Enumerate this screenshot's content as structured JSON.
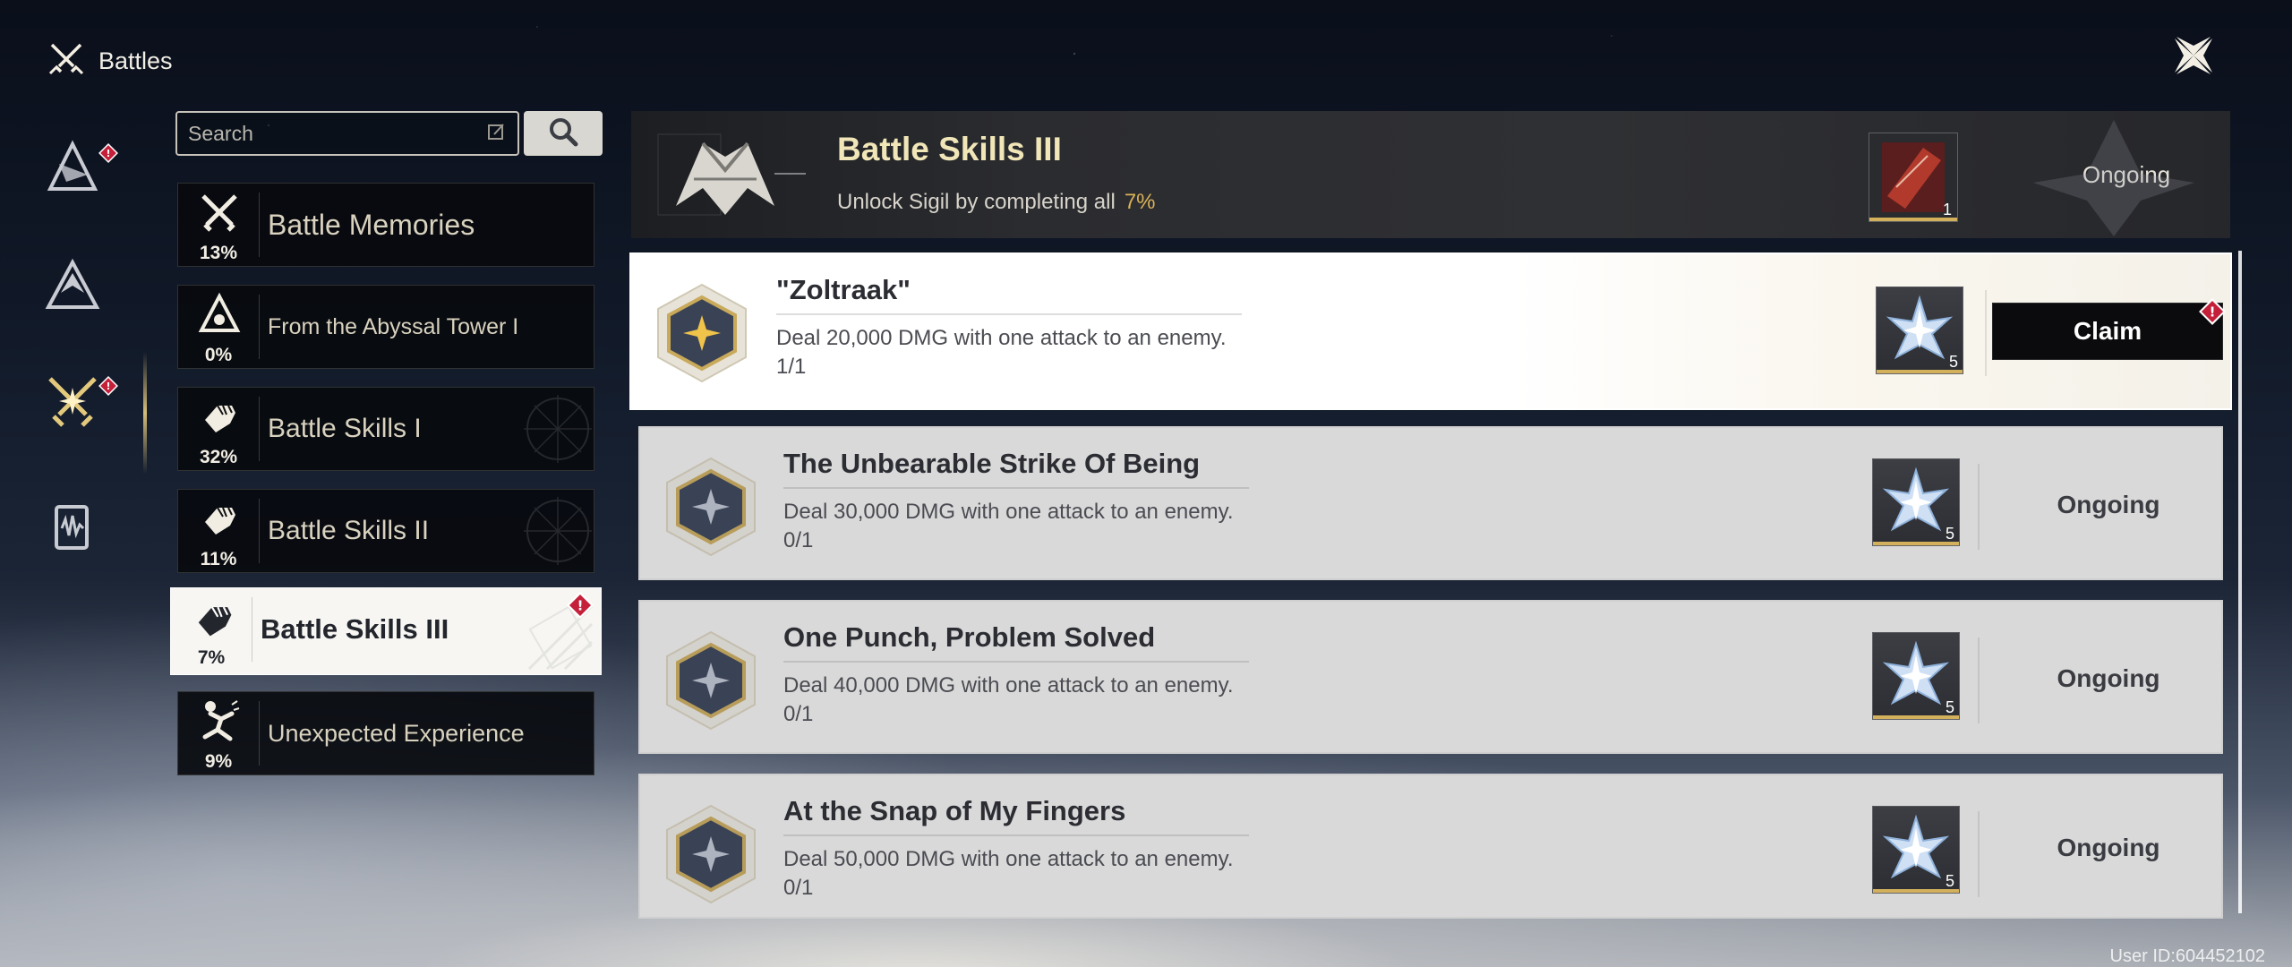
{
  "header": {
    "title": "Battles"
  },
  "search": {
    "placeholder": "Search"
  },
  "categories": [
    {
      "label": "Battle Memories",
      "pct": "13%"
    },
    {
      "label": "From the Abyssal Tower I",
      "pct": "0%"
    },
    {
      "label": "Battle Skills I",
      "pct": "32%"
    },
    {
      "label": "Battle Skills II",
      "pct": "11%"
    },
    {
      "label": "Battle Skills III",
      "pct": "7%"
    },
    {
      "label": "Unexpected Experience",
      "pct": "9%"
    }
  ],
  "banner": {
    "title": "Battle Skills III",
    "subtitle": "Unlock Sigil by completing all",
    "pct": "7%",
    "reward_qty": "1",
    "status": "Ongoing"
  },
  "tasks": [
    {
      "title": "\"Zoltraak\"",
      "desc": "Deal 20,000 DMG with one attack to an enemy.",
      "progress": "1/1",
      "reward_qty": "5",
      "action": "Claim"
    },
    {
      "title": "The Unbearable Strike Of Being",
      "desc": "Deal 30,000 DMG with one attack to an enemy.",
      "progress": "0/1",
      "reward_qty": "5",
      "status": "Ongoing"
    },
    {
      "title": "One Punch, Problem Solved",
      "desc": "Deal 40,000 DMG with one attack to an enemy.",
      "progress": "0/1",
      "reward_qty": "5",
      "status": "Ongoing"
    },
    {
      "title": "At the Snap of My Fingers",
      "desc": "Deal 50,000 DMG with one attack to an enemy.",
      "progress": "0/1",
      "reward_qty": "5",
      "status": "Ongoing"
    }
  ],
  "footer": {
    "uid": "User ID:604452102"
  },
  "colors": {
    "accent_gold": "#d5bd7a",
    "badge_red": "#c4203a",
    "pct_gold": "#d9b257"
  }
}
